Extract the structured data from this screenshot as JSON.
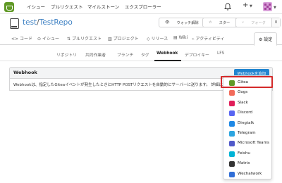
{
  "nav": {
    "issues": "イシュー",
    "pulls": "プルリクエスト",
    "milestones": "マイルストーン",
    "explore": "エクスプローラー",
    "plus": "+"
  },
  "repo": {
    "owner": "test",
    "separator": "/",
    "name": "TestRepo",
    "watch_label": "ウォッチ解除",
    "watch_count": "1",
    "star_label": "スター",
    "star_count": "0",
    "fork_label": "フォーク",
    "fork_count": "0"
  },
  "tabs": {
    "code": "<> コード",
    "issues": "イシュー",
    "pulls": "プルリクエスト",
    "projects": "プロジェクト",
    "releases": "リリース",
    "wiki": "Wiki",
    "activity": "アクティビティ",
    "settings": "設定"
  },
  "settings_menu": {
    "repository": "リポジトリ",
    "collaborators": "共同作業者",
    "branches": "ブランチ",
    "tags": "タグ",
    "webhook": "Webhook",
    "deploy_keys": "デプロイキー",
    "lfs": "LFS"
  },
  "panel": {
    "title": "Webhook",
    "add_button": "Webhookを追加",
    "description": "Webhookは、指定したGiteaイベントが発生したときにHTTP POSTリクエストを自動的にサーバーに送ります。 詳細は"
  },
  "dropdown": {
    "items": [
      {
        "label": "Gitea",
        "icon": "gitea-icon",
        "color": "#609926"
      },
      {
        "label": "Gogs",
        "icon": "gogs-icon",
        "color": "#f26b5b"
      },
      {
        "label": "Slack",
        "icon": "slack-icon",
        "color": "#e01e5a"
      },
      {
        "label": "Discord",
        "icon": "discord-icon",
        "color": "#5865f2"
      },
      {
        "label": "Dingtalk",
        "icon": "dingtalk-icon",
        "color": "#1e88e5"
      },
      {
        "label": "Telegram",
        "icon": "telegram-icon",
        "color": "#2ca5e0"
      },
      {
        "label": "Microsoft Teams",
        "icon": "msteams-icon",
        "color": "#5059c9"
      },
      {
        "label": "Feishu",
        "icon": "feishu-icon",
        "color": "#00b3d6"
      },
      {
        "label": "Matrix",
        "icon": "matrix-icon",
        "color": "#333333"
      },
      {
        "label": "Wechatwork",
        "icon": "wechatwork-icon",
        "color": "#2f6dd6"
      }
    ]
  }
}
